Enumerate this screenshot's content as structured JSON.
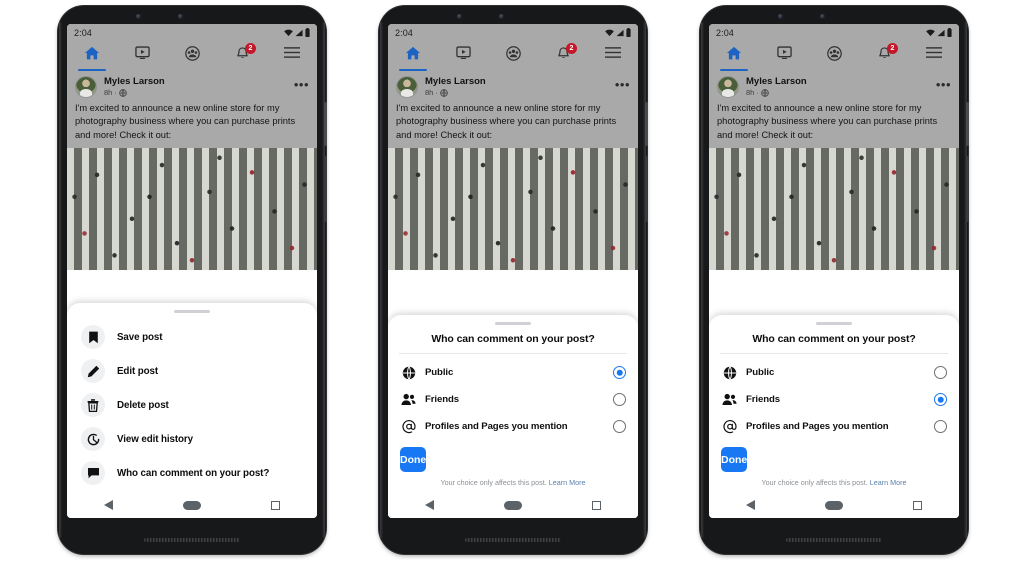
{
  "statusbar": {
    "time": "2:04",
    "icons": [
      "wifi-icon",
      "signal-icon",
      "battery-icon"
    ]
  },
  "fbnav": {
    "items": [
      {
        "name": "home",
        "icon": "home-icon",
        "active": true,
        "badge": ""
      },
      {
        "name": "watch",
        "icon": "video-icon",
        "active": false,
        "badge": ""
      },
      {
        "name": "groups",
        "icon": "groups-icon",
        "active": false,
        "badge": ""
      },
      {
        "name": "notifications",
        "icon": "bell-icon",
        "active": false,
        "badge": "2"
      },
      {
        "name": "menu",
        "icon": "hamburger-icon",
        "active": false,
        "badge": ""
      }
    ]
  },
  "post": {
    "author": "Myles Larson",
    "time": "8h",
    "separator": "·",
    "audience_icon": "globe-icon",
    "more_label": "•••",
    "text": "I'm excited to announce a new online store for my photography business where you can purchase prints and more! Check it out:",
    "photo_alt": "aerial-crosswalk-photo"
  },
  "menu_sheet": {
    "items": [
      {
        "label": "Save post",
        "icon": "bookmark-icon"
      },
      {
        "label": "Edit post",
        "icon": "pencil-icon"
      },
      {
        "label": "Delete post",
        "icon": "trash-icon"
      },
      {
        "label": "View edit history",
        "icon": "history-clock-icon"
      },
      {
        "label": "Who can comment on your post?",
        "icon": "speech-bubble-icon"
      }
    ]
  },
  "dialog": {
    "title": "Who can comment on your post?",
    "options": [
      {
        "label": "Public",
        "icon": "globe-icon"
      },
      {
        "label": "Friends",
        "icon": "people-icon"
      },
      {
        "label": "Profiles and Pages you mention",
        "icon": "at-mention-icon"
      }
    ],
    "done_label": "Done",
    "footer_text": "Your choice only affects this post.",
    "footer_link": "Learn More"
  },
  "phones": [
    {
      "id": "phone-1",
      "sheet": "menu",
      "selected_option": null
    },
    {
      "id": "phone-2",
      "sheet": "dialog",
      "selected_option": 0
    },
    {
      "id": "phone-3",
      "sheet": "dialog",
      "selected_option": 1
    }
  ],
  "androidnav": {
    "back": "back-triangle-icon",
    "home": "home-pill-icon",
    "recents": "recents-square-icon"
  },
  "colors": {
    "facebook_blue": "#1877F2",
    "nav_active_blue": "#1C63C4",
    "badge_red": "#C4172A",
    "chrome_grey": "#A9A9A9",
    "link_blue": "#5A7FAE"
  }
}
